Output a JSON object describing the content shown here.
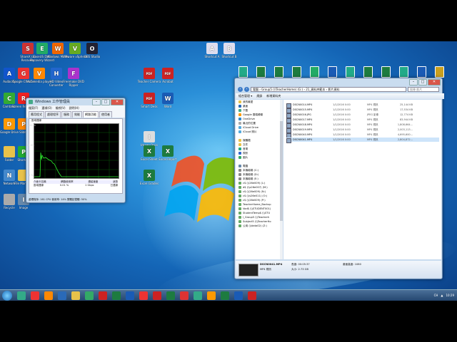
{
  "desktop_icons": [
    {
      "label": "ShareX (a) Recovery",
      "x": "20",
      "y": "60",
      "color": "#c33",
      "glyph": "S"
    },
    {
      "label": "EaseUS Data Recovery Wizard",
      "x": "40",
      "y": "60",
      "color": "#2a6",
      "glyph": "E"
    },
    {
      "label": "Windows Movie",
      "x": "62",
      "y": "60",
      "color": "#e60",
      "glyph": "W"
    },
    {
      "label": "VMware vSphere",
      "x": "86",
      "y": "60",
      "color": "#6a2",
      "glyph": "V"
    },
    {
      "label": "OBS Studio",
      "x": "110",
      "y": "60",
      "color": "#223",
      "glyph": "O"
    },
    {
      "label": "Audacity",
      "x": "-6",
      "y": "95",
      "color": "#15c",
      "glyph": "A"
    },
    {
      "label": "Google Chrome",
      "x": "14",
      "y": "95",
      "color": "#e33",
      "glyph": "G"
    },
    {
      "label": "VLC media player",
      "x": "36",
      "y": "95",
      "color": "#f80",
      "glyph": "V"
    },
    {
      "label": "HD Video Converter",
      "x": "60",
      "y": "95",
      "color": "#26c",
      "glyph": "H"
    },
    {
      "label": "Freemake DVD Ripper",
      "x": "84",
      "y": "95",
      "color": "#a3c",
      "glyph": "F"
    },
    {
      "label": "Teacher Camera",
      "x": "190",
      "y": "95",
      "color": "#c22",
      "glyph": "PDF"
    },
    {
      "label": "Acrobat",
      "x": "216",
      "y": "95",
      "color": "#c22",
      "glyph": "PDF"
    },
    {
      "label": "Camtasia",
      "x": "-6",
      "y": "130",
      "color": "#3a3",
      "glyph": "C"
    },
    {
      "label": "Screen Recorder",
      "x": "14",
      "y": "130",
      "color": "#e22",
      "glyph": "R"
    },
    {
      "label": "Smart Desk",
      "x": "190",
      "y": "130",
      "color": "#c22",
      "glyph": "PDF"
    },
    {
      "label": "Word",
      "x": "216",
      "y": "130",
      "color": "#1a5bb5",
      "glyph": "W"
    },
    {
      "label": "Google Drive",
      "x": "-6",
      "y": "166",
      "color": "#f90",
      "glyph": "D"
    },
    {
      "label": "Slides",
      "x": "14",
      "y": "166",
      "color": "#f80",
      "glyph": "P"
    },
    {
      "label": "Image Docs",
      "x": "190",
      "y": "184",
      "color": "#ddd",
      "glyph": "I"
    },
    {
      "label": "Excel Sheet",
      "x": "190",
      "y": "204",
      "color": "#1d7b40",
      "glyph": "X"
    },
    {
      "label": "Excel Grades",
      "x": "190",
      "y": "238",
      "color": "#1d7b40",
      "glyph": "X"
    },
    {
      "label": "Excel Report",
      "x": "216",
      "y": "204",
      "color": "#1d7b40",
      "glyph": "X"
    },
    {
      "label": "Folder",
      "x": "-6",
      "y": "205",
      "color": "#e8c24a",
      "glyph": ""
    },
    {
      "label": "Shortcut",
      "x": "14",
      "y": "205",
      "color": "#2a3",
      "glyph": "P"
    },
    {
      "label": "Network",
      "x": "-6",
      "y": "238",
      "color": "#48c",
      "glyph": "N"
    },
    {
      "label": "File Manager",
      "x": "14",
      "y": "238",
      "color": "#e8c24a",
      "glyph": ""
    },
    {
      "label": "Recycle",
      "x": "-6",
      "y": "272",
      "color": "#aaa",
      "glyph": ""
    },
    {
      "label": "Image",
      "x": "14",
      "y": "272",
      "color": "#68a",
      "glyph": "I"
    },
    {
      "label": "Shortcut A",
      "x": "278",
      "y": "60",
      "color": "#dde",
      "glyph": "A"
    },
    {
      "label": "Shortcut B",
      "x": "302",
      "y": "60",
      "color": "#dde",
      "glyph": "B"
    }
  ],
  "top_icons": [
    "#2a8",
    "#1d7b40",
    "#1d7b40",
    "#1d7b40",
    "#2a6",
    "#1a5bb5",
    "#2a8",
    "#1d7b40",
    "#1d7b40",
    "#2a8",
    "#1a5bb5",
    "#c9a020"
  ],
  "task_manager": {
    "title": "Windows 工作管理員",
    "menu": [
      "檔案(F)",
      "選項(O)",
      "檢視(V)",
      "說明(H)"
    ],
    "tabs": [
      "應用程式",
      "處理程序",
      "服務",
      "效能",
      "網路功能",
      "使用者"
    ],
    "active_tab": "網路功能",
    "graph_label": "區域連線",
    "graph_top": "100 %",
    "graph_mid": "12.5%",
    "graph_bot": "0 %",
    "legend_headers": [
      "介面卡名稱",
      "網路使用率",
      "連結速度",
      "狀態"
    ],
    "legend_row": [
      "區域連線",
      "0.01 %",
      "1 Gbps",
      "已連線"
    ],
    "status": "處理程序: 161    CPU 使用率: 14%    實體記憶體: 50%"
  },
  "explorer": {
    "address": "電腦 › Group5 (\\\\TeacherHome) (G:) › 21_資料夾範本 › 影片資料",
    "search_placeholder": "搜尋 影片",
    "toolbar": [
      "組合管理 ▾",
      "燒錄",
      "新增資料夾"
    ],
    "nav": [
      {
        "label": "我的最愛",
        "color": "#e8c24a"
      },
      {
        "label": "桌面",
        "color": "#2a6ab8"
      },
      {
        "label": "下載",
        "color": "#4a8"
      },
      {
        "label": "Google 雲端硬碟",
        "color": "#f90"
      },
      {
        "label": "OneDrive",
        "color": "#38c"
      },
      {
        "label": "最近的位置",
        "color": "#aaa"
      },
      {
        "label": "iCloud Drive",
        "color": "#5ad"
      },
      {
        "label": "iCloud 照片",
        "color": "#5ad"
      },
      {
        "label": "",
        "color": ""
      },
      {
        "label": "媒體櫃",
        "color": "#e8c24a"
      },
      {
        "label": "文件",
        "color": "#e8c24a"
      },
      {
        "label": "音樂",
        "color": "#2a8"
      },
      {
        "label": "視訊",
        "color": "#36c"
      },
      {
        "label": "圖片",
        "color": "#3a6"
      },
      {
        "label": "",
        "color": ""
      },
      {
        "label": "電腦",
        "color": "#68a"
      },
      {
        "label": "本機磁碟 (C:)",
        "color": "#888"
      },
      {
        "label": "本機磁碟 (D:)",
        "color": "#888"
      },
      {
        "label": "本機磁碟 (E:)",
        "color": "#888"
      },
      {
        "label": "c$ (\\\\26e009) (L:)",
        "color": "#6a6"
      },
      {
        "label": "d$ (\\\\s26e007) (M:)",
        "color": "#6a6"
      },
      {
        "label": "c$ (\\\\26e009) (N:)",
        "color": "#6a6"
      },
      {
        "label": "c$ (\\\\s26e011) (O:)",
        "color": "#6a6"
      },
      {
        "label": "c$ (\\\\26e009) (P:)",
        "color": "#6a6"
      },
      {
        "label": "TeacherHome_Backup",
        "color": "#6a6"
      },
      {
        "label": "Vod$ (\\\\STUDENT001)",
        "color": "#6a6"
      },
      {
        "label": "StudentTemp$ (\\\\STU",
        "color": "#6a6"
      },
      {
        "label": "I_Group5 (\\\\Teacherh",
        "color": "#6a6"
      },
      {
        "label": "Subject5 (\\\\TeacherHo",
        "color": "#6a6"
      },
      {
        "label": "公用 (\\\\data02) (Z:)",
        "color": "#6a6"
      }
    ],
    "files": [
      {
        "name": "DSCN0014.MP4",
        "date": "1/1/2016 0:00",
        "type": "MP4 視訊",
        "size": "25,144 KB"
      },
      {
        "name": "DSCN0015.MP4",
        "date": "1/1/2016 0:00",
        "type": "MP4 視訊",
        "size": "17,534 KB"
      },
      {
        "name": "DSCN0016.JPG",
        "date": "1/1/2016 0:00",
        "type": "JPEG 影像",
        "size": "12,774 KB"
      },
      {
        "name": "DSCN0017.MP4",
        "date": "1/1/2016 0:00",
        "type": "MP4 視訊",
        "size": "83,944 KB"
      },
      {
        "name": "DSCN0018.MP4",
        "date": "1/1/2016 0:00",
        "type": "MP4 視訊",
        "size": "1,808,664..."
      },
      {
        "name": "DSCN0019.MP4",
        "date": "1/1/2016 0:00",
        "type": "MP4 視訊",
        "size": "2,003,113..."
      },
      {
        "name": "DSCN0040.MP4",
        "date": "1/1/2016 0:00",
        "type": "MP4 視訊",
        "size": "4,695,600..."
      },
      {
        "name": "DSCN0041.MP4",
        "date": "1/1/2016 0:00",
        "type": "MP4 視訊",
        "size": "2,804,872..."
      }
    ],
    "details": {
      "name": "DSCN0041.MP4",
      "type": "MP4 視訊",
      "date_label": "修改日期: 1/1/2016 00:00",
      "length": "長度: 00:05:37",
      "size": "大小: 2.73 GB",
      "frame": "畫面高度: 1080"
    }
  },
  "taskbar": {
    "buttons": [
      "#3a8",
      "#e33",
      "#f80",
      "#2a6ab8",
      "#e8c24a",
      "#3a6",
      "#c22",
      "#1d7b40",
      "#1a5bb5",
      "#e33",
      "#c22",
      "#1d7b40",
      "#d33",
      "#3a8",
      "#f90",
      "#1d7b40",
      "#1a5bb5",
      "#c22"
    ],
    "tray": [
      "CH",
      "▲",
      "10:29"
    ]
  }
}
